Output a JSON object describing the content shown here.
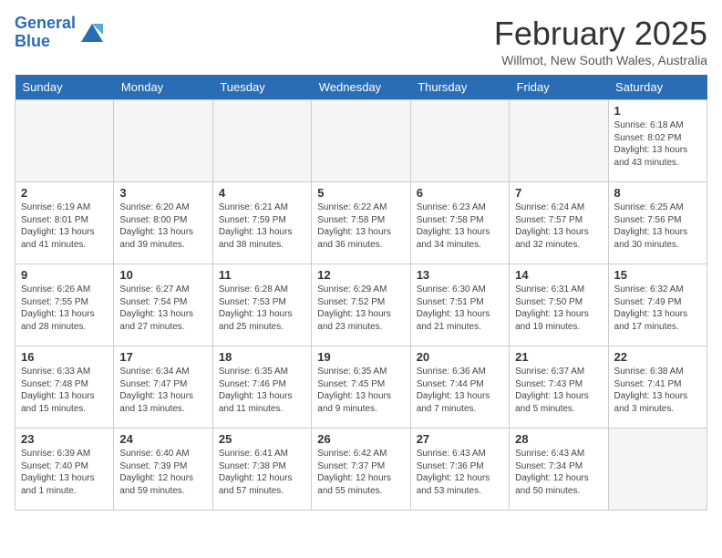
{
  "header": {
    "logo_line1": "General",
    "logo_line2": "Blue",
    "title": "February 2025",
    "subtitle": "Willmot, New South Wales, Australia"
  },
  "days_of_week": [
    "Sunday",
    "Monday",
    "Tuesday",
    "Wednesday",
    "Thursday",
    "Friday",
    "Saturday"
  ],
  "weeks": [
    [
      {
        "day": "",
        "info": ""
      },
      {
        "day": "",
        "info": ""
      },
      {
        "day": "",
        "info": ""
      },
      {
        "day": "",
        "info": ""
      },
      {
        "day": "",
        "info": ""
      },
      {
        "day": "",
        "info": ""
      },
      {
        "day": "1",
        "info": "Sunrise: 6:18 AM\nSunset: 8:02 PM\nDaylight: 13 hours\nand 43 minutes."
      }
    ],
    [
      {
        "day": "2",
        "info": "Sunrise: 6:19 AM\nSunset: 8:01 PM\nDaylight: 13 hours\nand 41 minutes."
      },
      {
        "day": "3",
        "info": "Sunrise: 6:20 AM\nSunset: 8:00 PM\nDaylight: 13 hours\nand 39 minutes."
      },
      {
        "day": "4",
        "info": "Sunrise: 6:21 AM\nSunset: 7:59 PM\nDaylight: 13 hours\nand 38 minutes."
      },
      {
        "day": "5",
        "info": "Sunrise: 6:22 AM\nSunset: 7:58 PM\nDaylight: 13 hours\nand 36 minutes."
      },
      {
        "day": "6",
        "info": "Sunrise: 6:23 AM\nSunset: 7:58 PM\nDaylight: 13 hours\nand 34 minutes."
      },
      {
        "day": "7",
        "info": "Sunrise: 6:24 AM\nSunset: 7:57 PM\nDaylight: 13 hours\nand 32 minutes."
      },
      {
        "day": "8",
        "info": "Sunrise: 6:25 AM\nSunset: 7:56 PM\nDaylight: 13 hours\nand 30 minutes."
      }
    ],
    [
      {
        "day": "9",
        "info": "Sunrise: 6:26 AM\nSunset: 7:55 PM\nDaylight: 13 hours\nand 28 minutes."
      },
      {
        "day": "10",
        "info": "Sunrise: 6:27 AM\nSunset: 7:54 PM\nDaylight: 13 hours\nand 27 minutes."
      },
      {
        "day": "11",
        "info": "Sunrise: 6:28 AM\nSunset: 7:53 PM\nDaylight: 13 hours\nand 25 minutes."
      },
      {
        "day": "12",
        "info": "Sunrise: 6:29 AM\nSunset: 7:52 PM\nDaylight: 13 hours\nand 23 minutes."
      },
      {
        "day": "13",
        "info": "Sunrise: 6:30 AM\nSunset: 7:51 PM\nDaylight: 13 hours\nand 21 minutes."
      },
      {
        "day": "14",
        "info": "Sunrise: 6:31 AM\nSunset: 7:50 PM\nDaylight: 13 hours\nand 19 minutes."
      },
      {
        "day": "15",
        "info": "Sunrise: 6:32 AM\nSunset: 7:49 PM\nDaylight: 13 hours\nand 17 minutes."
      }
    ],
    [
      {
        "day": "16",
        "info": "Sunrise: 6:33 AM\nSunset: 7:48 PM\nDaylight: 13 hours\nand 15 minutes."
      },
      {
        "day": "17",
        "info": "Sunrise: 6:34 AM\nSunset: 7:47 PM\nDaylight: 13 hours\nand 13 minutes."
      },
      {
        "day": "18",
        "info": "Sunrise: 6:35 AM\nSunset: 7:46 PM\nDaylight: 13 hours\nand 11 minutes."
      },
      {
        "day": "19",
        "info": "Sunrise: 6:35 AM\nSunset: 7:45 PM\nDaylight: 13 hours\nand 9 minutes."
      },
      {
        "day": "20",
        "info": "Sunrise: 6:36 AM\nSunset: 7:44 PM\nDaylight: 13 hours\nand 7 minutes."
      },
      {
        "day": "21",
        "info": "Sunrise: 6:37 AM\nSunset: 7:43 PM\nDaylight: 13 hours\nand 5 minutes."
      },
      {
        "day": "22",
        "info": "Sunrise: 6:38 AM\nSunset: 7:41 PM\nDaylight: 13 hours\nand 3 minutes."
      }
    ],
    [
      {
        "day": "23",
        "info": "Sunrise: 6:39 AM\nSunset: 7:40 PM\nDaylight: 13 hours\nand 1 minute."
      },
      {
        "day": "24",
        "info": "Sunrise: 6:40 AM\nSunset: 7:39 PM\nDaylight: 12 hours\nand 59 minutes."
      },
      {
        "day": "25",
        "info": "Sunrise: 6:41 AM\nSunset: 7:38 PM\nDaylight: 12 hours\nand 57 minutes."
      },
      {
        "day": "26",
        "info": "Sunrise: 6:42 AM\nSunset: 7:37 PM\nDaylight: 12 hours\nand 55 minutes."
      },
      {
        "day": "27",
        "info": "Sunrise: 6:43 AM\nSunset: 7:36 PM\nDaylight: 12 hours\nand 53 minutes."
      },
      {
        "day": "28",
        "info": "Sunrise: 6:43 AM\nSunset: 7:34 PM\nDaylight: 12 hours\nand 50 minutes."
      },
      {
        "day": "",
        "info": ""
      }
    ]
  ]
}
